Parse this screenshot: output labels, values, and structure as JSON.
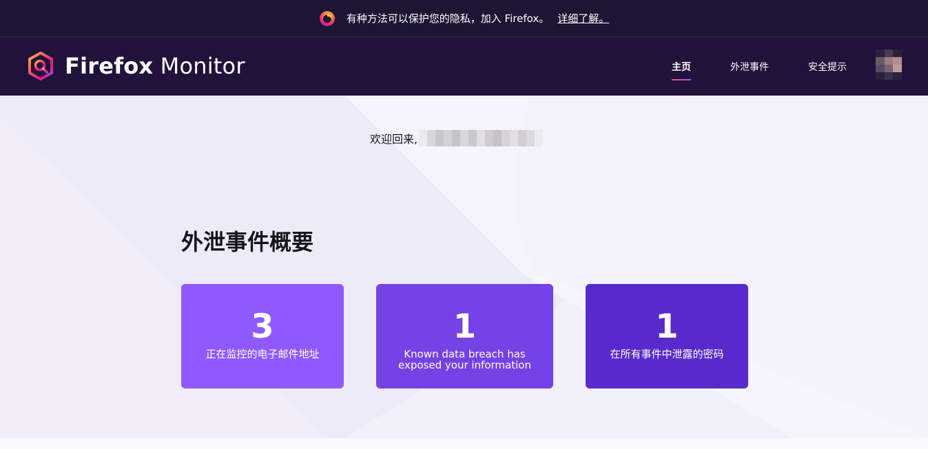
{
  "promo": {
    "text": "有种方法可以保护您的隐私，加入 Firefox。",
    "link": "详细了解。",
    "icon": "firefox-icon"
  },
  "nav": {
    "brand_bold": "Firefox",
    "brand_light": " Monitor",
    "links": [
      {
        "label": "主页",
        "active": true
      },
      {
        "label": "外泄事件",
        "active": false
      },
      {
        "label": "安全提示",
        "active": false
      }
    ]
  },
  "main": {
    "welcome": "欢迎回来,",
    "section_title": "外泄事件概要",
    "stats": [
      {
        "value": "3",
        "label": "正在监控的电子邮件地址",
        "color": "#9059ff"
      },
      {
        "value": "1",
        "label": "Known data breach has exposed your information",
        "color": "#7542e5"
      },
      {
        "value": "1",
        "label": "在所有事件中泄露的密码",
        "color": "#592acb"
      }
    ]
  },
  "colors": {
    "promo_bg": "#1c1533",
    "nav_bg": "#20123a",
    "hero_bg": "#f2f0fa",
    "accent_gradient": [
      "#ff4f5e",
      "#9059ff"
    ]
  }
}
